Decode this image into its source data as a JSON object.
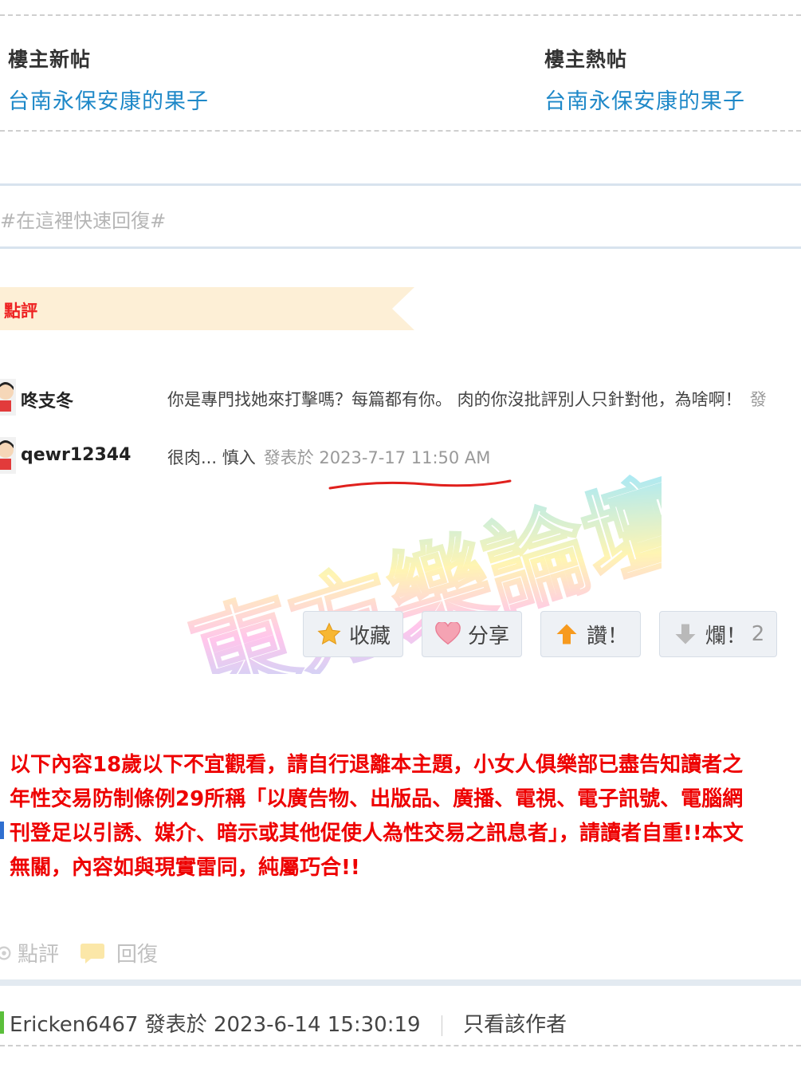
{
  "threads": {
    "left": {
      "heading": "樓主新帖",
      "link": "台南永保安康的果子"
    },
    "right": {
      "heading": "樓主熱帖",
      "link": "台南永保安康的果子"
    }
  },
  "quick_reply": {
    "placeholder": "#在這裡快速回復#"
  },
  "rating": {
    "label": "點評"
  },
  "comments": [
    {
      "user": "咚支冬",
      "text": "你是專門找她來打擊嗎？每篇都有你。 肉的你沒批評別人只針對他，為啥啊！",
      "meta": "發"
    },
    {
      "user": "qewr12344",
      "text": "很肉... 慎入",
      "meta": "發表於 2023-7-17 11:50 AM"
    }
  ],
  "watermark": "東方樂論壇",
  "actions": {
    "favorite": "收藏",
    "share": "分享",
    "like": "讚！",
    "dislike": "爛！",
    "dislike_count": "2"
  },
  "notice": [
    "以下內容18歲以下不宜觀看，請自行退離本主題，小女人俱樂部已盡告知讀者之",
    "年性交易防制條例29所稱「以廣告物、出版品、廣播、電視、電子訊號、電腦網",
    "刊登足以引誘、媒介、暗示或其他促使人為性交易之訊息者」，請讀者自重!!本文",
    "無關，內容如與現實雷同，純屬巧合!!"
  ],
  "post_actions": {
    "rate": "點評",
    "reply": "回復"
  },
  "post_header": {
    "author": "Ericken6467",
    "posted": "發表於 2023-6-14 15:30:19",
    "only_author": "只看該作者"
  },
  "colors": {
    "link": "#1e88c8",
    "notice_red": "#e00000",
    "banner": "#fdefd6",
    "separator": "#e3eaf1"
  }
}
